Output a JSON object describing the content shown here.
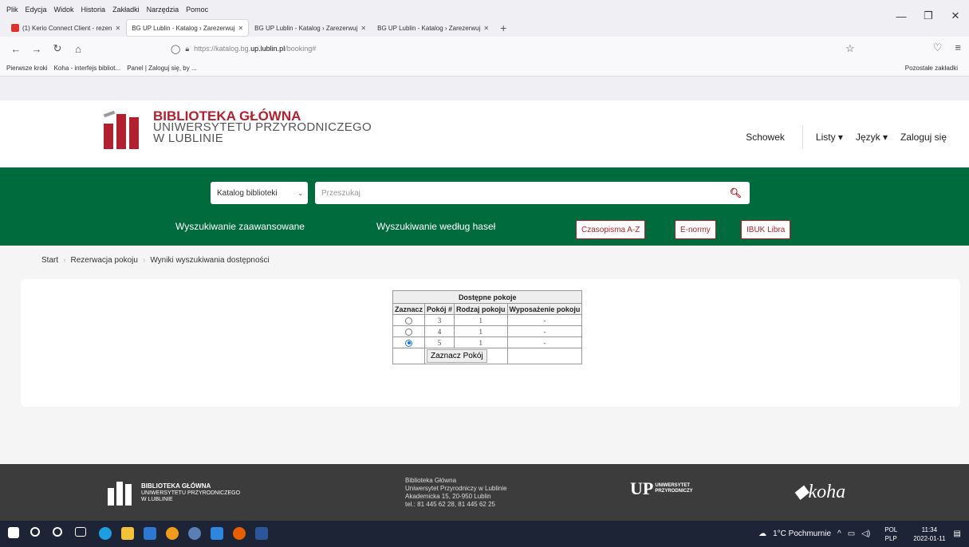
{
  "browser": {
    "menu": [
      "Plik",
      "Edycja",
      "Widok",
      "Historia",
      "Zakładki",
      "Narzędzia",
      "Pomoc"
    ],
    "tabs": [
      {
        "label": "(1) Kerio Connect Client - rezen",
        "active": false
      },
      {
        "label": "BG UP Lublin - Katalog › Zarezerwuj",
        "active": true
      },
      {
        "label": "BG UP Lublin - Katalog › Zarezerwuj",
        "active": false
      },
      {
        "label": "BG UP Lublin - Katalog › Zarezerwuj",
        "active": false
      }
    ],
    "url": {
      "prefix": "https://katalog.bg.",
      "domain": "up.lublin.pl",
      "path": "/booking#"
    },
    "bookmarks": [
      "Pierwsze kroki",
      "Koha - interfejs bibliot...",
      "Panel | Zaloguj się, by ..."
    ],
    "other_bookmarks": "Pozostałe zakładki"
  },
  "header": {
    "logo_line1": "BIBLIOTEKA GŁÓWNA",
    "logo_line2": "UNIWERSYTETU PRZYRODNICZEGO",
    "logo_line3": "W LUBLINIE",
    "nav": {
      "schowek": "Schowek",
      "listy": "Listy ▾",
      "jezyk": "Język ▾",
      "login": "Zaloguj się"
    }
  },
  "search": {
    "catalog_select": "Katalog biblioteki",
    "placeholder": "Przeszukaj",
    "advanced": "Wyszukiwanie zaawansowane",
    "by_subject": "Wyszukiwanie według haseł",
    "btn_journals": "Czasopisma A-Z",
    "btn_enormy": "E-normy",
    "btn_ibuk": "IBUK Libra"
  },
  "breadcrumb": [
    "Start",
    "Rezerwacja pokoju",
    "Wyniki wyszukiwania dostępności"
  ],
  "rooms_table": {
    "caption": "Dostępne pokoje",
    "headers": [
      "Zaznacz",
      "Pokój #",
      "Rodzaj pokoju",
      "Wyposażenie pokoju"
    ],
    "rows": [
      {
        "room": "3",
        "type": "1",
        "equipment": "-",
        "selected": false
      },
      {
        "room": "4",
        "type": "1",
        "equipment": "-",
        "selected": false
      },
      {
        "room": "5",
        "type": "1",
        "equipment": "-",
        "selected": true
      }
    ],
    "submit": "Zaznacz Pokój"
  },
  "footer": {
    "logo_line1": "BIBLIOTEKA GŁÓWNA",
    "logo_line2": "UNIWERSYTETU PRZYRODNICZEGO",
    "logo_line3": "W LUBLINIE",
    "address": [
      "Biblioteka Główna",
      "Uniwersytet Przyrodniczy w Lublinie",
      "Akademicka 15, 20-950 Lublin",
      "tel.: 81 445 62 28, 81 445 62 25"
    ],
    "up_line1": "UNIWERSYTET",
    "up_line2": "PRZYRODNICZY",
    "koha": "koha"
  },
  "taskbar": {
    "weather": "1°C Pochmurnie",
    "lang1": "POL",
    "lang2": "PLP",
    "time": "11:34",
    "date": "2022-01-11"
  }
}
